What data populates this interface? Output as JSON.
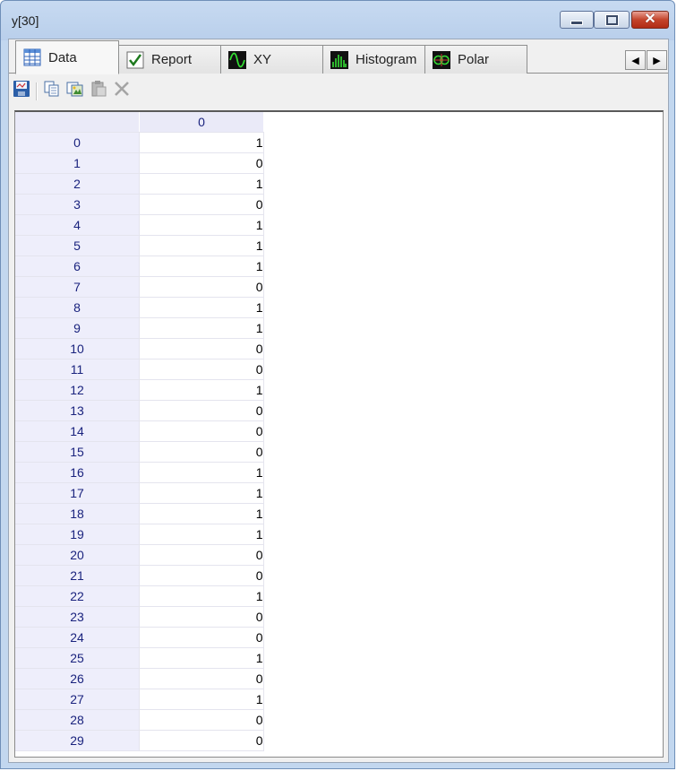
{
  "window": {
    "title": "y[30]"
  },
  "tabs": [
    {
      "label": "Data",
      "icon": "table-icon"
    },
    {
      "label": "Report",
      "icon": "checkmark-icon"
    },
    {
      "label": "XY",
      "icon": "xy-plot-icon"
    },
    {
      "label": "Histogram",
      "icon": "histogram-icon"
    },
    {
      "label": "Polar",
      "icon": "polar-plot-icon"
    }
  ],
  "active_tab": "Data",
  "toolbar": {
    "buttons": [
      "save-icon",
      "copy-icon",
      "copy-image-icon",
      "paste-icon",
      "delete-icon"
    ]
  },
  "grid": {
    "column_header": "0",
    "rows": [
      {
        "index": "0",
        "value": "1"
      },
      {
        "index": "1",
        "value": "0"
      },
      {
        "index": "2",
        "value": "1"
      },
      {
        "index": "3",
        "value": "0"
      },
      {
        "index": "4",
        "value": "1"
      },
      {
        "index": "5",
        "value": "1"
      },
      {
        "index": "6",
        "value": "1"
      },
      {
        "index": "7",
        "value": "0"
      },
      {
        "index": "8",
        "value": "1"
      },
      {
        "index": "9",
        "value": "1"
      },
      {
        "index": "10",
        "value": "0"
      },
      {
        "index": "11",
        "value": "0"
      },
      {
        "index": "12",
        "value": "1"
      },
      {
        "index": "13",
        "value": "0"
      },
      {
        "index": "14",
        "value": "0"
      },
      {
        "index": "15",
        "value": "0"
      },
      {
        "index": "16",
        "value": "1"
      },
      {
        "index": "17",
        "value": "1"
      },
      {
        "index": "18",
        "value": "1"
      },
      {
        "index": "19",
        "value": "1"
      },
      {
        "index": "20",
        "value": "0"
      },
      {
        "index": "21",
        "value": "0"
      },
      {
        "index": "22",
        "value": "1"
      },
      {
        "index": "23",
        "value": "0"
      },
      {
        "index": "24",
        "value": "0"
      },
      {
        "index": "25",
        "value": "1"
      },
      {
        "index": "26",
        "value": "0"
      },
      {
        "index": "27",
        "value": "1"
      },
      {
        "index": "28",
        "value": "0"
      },
      {
        "index": "29",
        "value": "0"
      }
    ]
  },
  "colors": {
    "header_text": "#1a237e",
    "header_bg": "#eeeefb",
    "window_frame": "#b9cfeb"
  }
}
